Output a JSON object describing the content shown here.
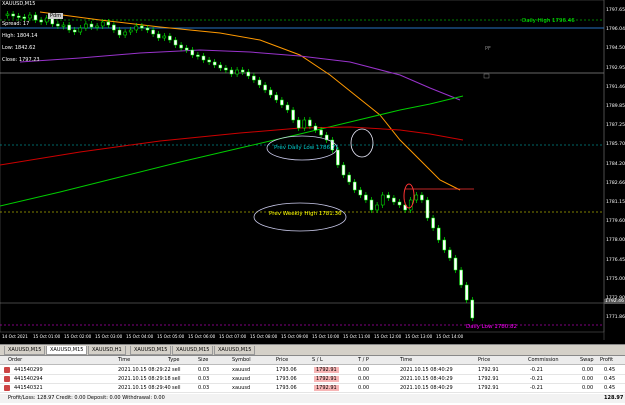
{
  "symbol_title": "XAUUSD,M15",
  "ohlc": {
    "spread": "Spread: 17",
    "high": "High: 1804.14",
    "low": "Low: 1842.62",
    "close": "Close: 1797.23"
  },
  "top_panel_label": "Pdm",
  "annotations": {
    "daily_high": "Daily High 1796.46",
    "prev_daily_low": "Prev Daily Low 1786.71",
    "prev_weekly_high": "Prev Weekly High 1781.36",
    "daily_low": "Daily Low 1780.82"
  },
  "price_axis": [
    "1797.65",
    "1796.04",
    "1794.50",
    "1792.95",
    "1791.46",
    "1789.85",
    "1787.25",
    "1785.70",
    "1784.20",
    "1782.66",
    "1781.15",
    "1779.60",
    "1778.00",
    "1776.45",
    "1775.00",
    "1772.90",
    "1771.86"
  ],
  "current_price": "1792.46",
  "time_axis": [
    "14 Oct 2021",
    "15 Oct 01:00",
    "15 Oct 02:00",
    "15 Oct 03:00",
    "15 Oct 04:00",
    "15 Oct 05:00",
    "15 Oct 06:00",
    "15 Oct 07:00",
    "15 Oct 08:00",
    "15 Oct 09:00",
    "15 Oct 10:00",
    "15 Oct 11:00",
    "15 Oct 12:00",
    "15 Oct 13:00",
    "15 Oct 14:00"
  ],
  "tabs": [
    "XAUUSD,M15",
    "XAUUSD,M15",
    "XAUUSD,H1",
    "XAUUSD,M15",
    "XAUUSD,M15",
    "XAUUSD,M15"
  ],
  "active_tab": 1,
  "columns": [
    "Order",
    "Time",
    "Type",
    "Size",
    "Symbol",
    "Price",
    "S / L",
    "T / P",
    "Time",
    "Price",
    "Commission",
    "Swap",
    "Profit"
  ],
  "orders": [
    {
      "order": "441540299",
      "time": "2021.10.15 08:29:22",
      "type": "sell",
      "size": "0.03",
      "symbol": "xauusd",
      "price": "1793.06",
      "sl": "1792.91",
      "tp": "0.00",
      "ctime": "2021.10.15 08:40:29",
      "cprice": "1792.91",
      "commission": "-0.21",
      "swap": "0.00",
      "profit": "0.45"
    },
    {
      "order": "441540294",
      "time": "2021.10.15 08:29:18",
      "type": "sell",
      "size": "0.03",
      "symbol": "xauusd",
      "price": "1793.06",
      "sl": "1792.91",
      "tp": "0.00",
      "ctime": "2021.10.15 08:40:29",
      "cprice": "1792.91",
      "commission": "-0.21",
      "swap": "0.00",
      "profit": "0.45"
    },
    {
      "order": "441540321",
      "time": "2021.10.15 08:29:40",
      "type": "sell",
      "size": "0.03",
      "symbol": "xauusd",
      "price": "1793.06",
      "sl": "1792.91",
      "tp": "0.00",
      "ctime": "2021.10.15 08:40:29",
      "cprice": "1792.91",
      "commission": "-0.21",
      "swap": "0.00",
      "profit": "0.45"
    }
  ],
  "summary": {
    "text": "Profit/Loss: 128.97  Credit: 0.00  Deposit: 0.00  Withdrawal: 0.00",
    "total": "128.97"
  },
  "colors": {
    "bull": "#ffffff",
    "bear": "#000000",
    "wick": "#00ff00",
    "ma_orange": "#ff9900",
    "ma_purple": "#9933cc",
    "ma_green": "#00cc00",
    "ma_red": "#cc0000",
    "daily_high": "#00ff00",
    "prev_level": "#00cccc",
    "weekly": "#ffff00",
    "daily_low": "#ff00ff"
  }
}
